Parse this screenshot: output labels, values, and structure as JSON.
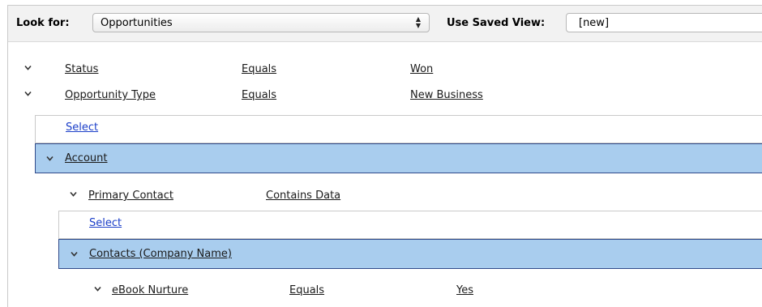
{
  "header": {
    "look_for_label": "Look for:",
    "look_for_value": "Opportunities",
    "saved_view_label": "Use Saved View:",
    "saved_view_value": "[new]"
  },
  "criteria": [
    {
      "field": "Status",
      "operator": "Equals",
      "value": "Won"
    },
    {
      "field": "Opportunity Type",
      "operator": "Equals",
      "value": "New Business"
    }
  ],
  "select_link": "Select",
  "account_group": {
    "label": "Account",
    "criteria": [
      {
        "field": "Primary Contact",
        "operator": "Contains Data",
        "value": ""
      }
    ],
    "select_link": "Select",
    "contacts_group": {
      "label": "Contacts (Company Name)",
      "criteria": [
        {
          "field": "eBook Nurture",
          "operator": "Equals",
          "value": "Yes"
        }
      ]
    }
  }
}
